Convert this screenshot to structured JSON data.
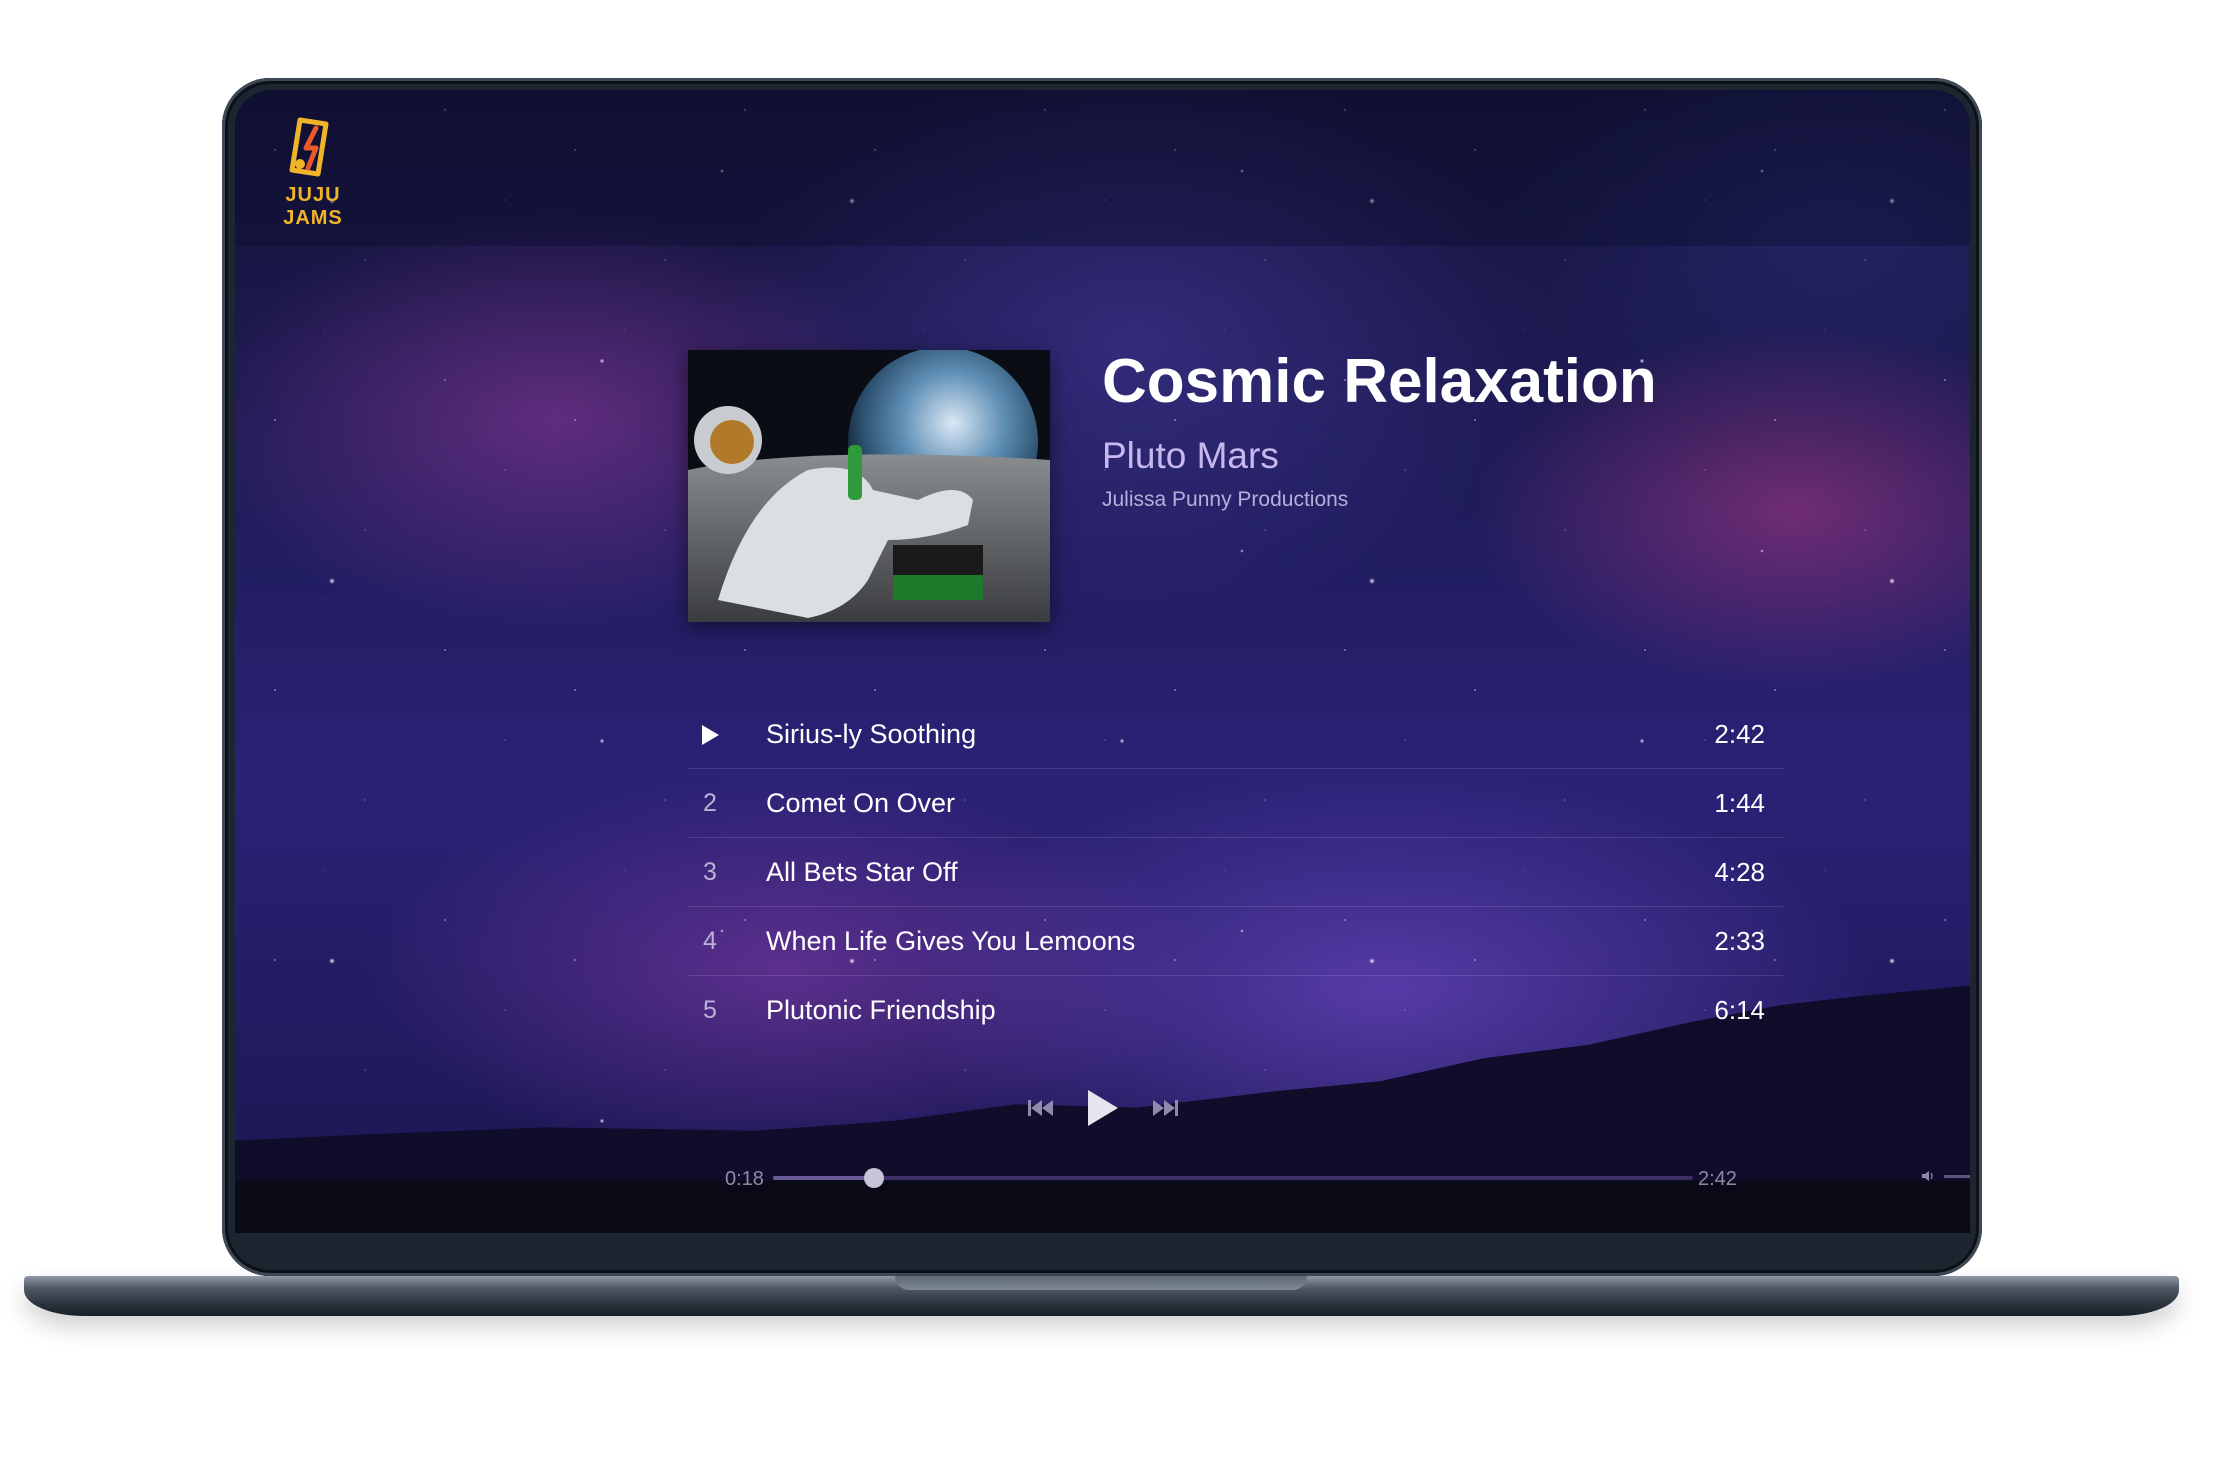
{
  "app": {
    "logo_text": "JUJU JAMS"
  },
  "album": {
    "title": "Cosmic Relaxation",
    "artist": "Pluto Mars",
    "label": "Julissa Punny Productions"
  },
  "tracks": [
    {
      "number": "",
      "name": "Sirius-ly Soothing",
      "duration": "2:42",
      "playing": true
    },
    {
      "number": "2",
      "name": "Comet On Over",
      "duration": "1:44"
    },
    {
      "number": "3",
      "name": "All Bets Star Off",
      "duration": "4:28"
    },
    {
      "number": "4",
      "name": "When Life Gives You Lemoons",
      "duration": "2:33"
    },
    {
      "number": "5",
      "name": "Plutonic Friendship",
      "duration": "6:14"
    }
  ],
  "player": {
    "current_time": "0:18",
    "total_time": "2:42",
    "progress_fraction": 0.11,
    "icons": [
      "previous-track-icon",
      "play-icon",
      "next-track-icon",
      "volume-icon"
    ]
  },
  "colors": {
    "accent_logo": "#f0b42a",
    "artist_text": "#c7b9ef",
    "progress_track": "#3d2f66"
  }
}
